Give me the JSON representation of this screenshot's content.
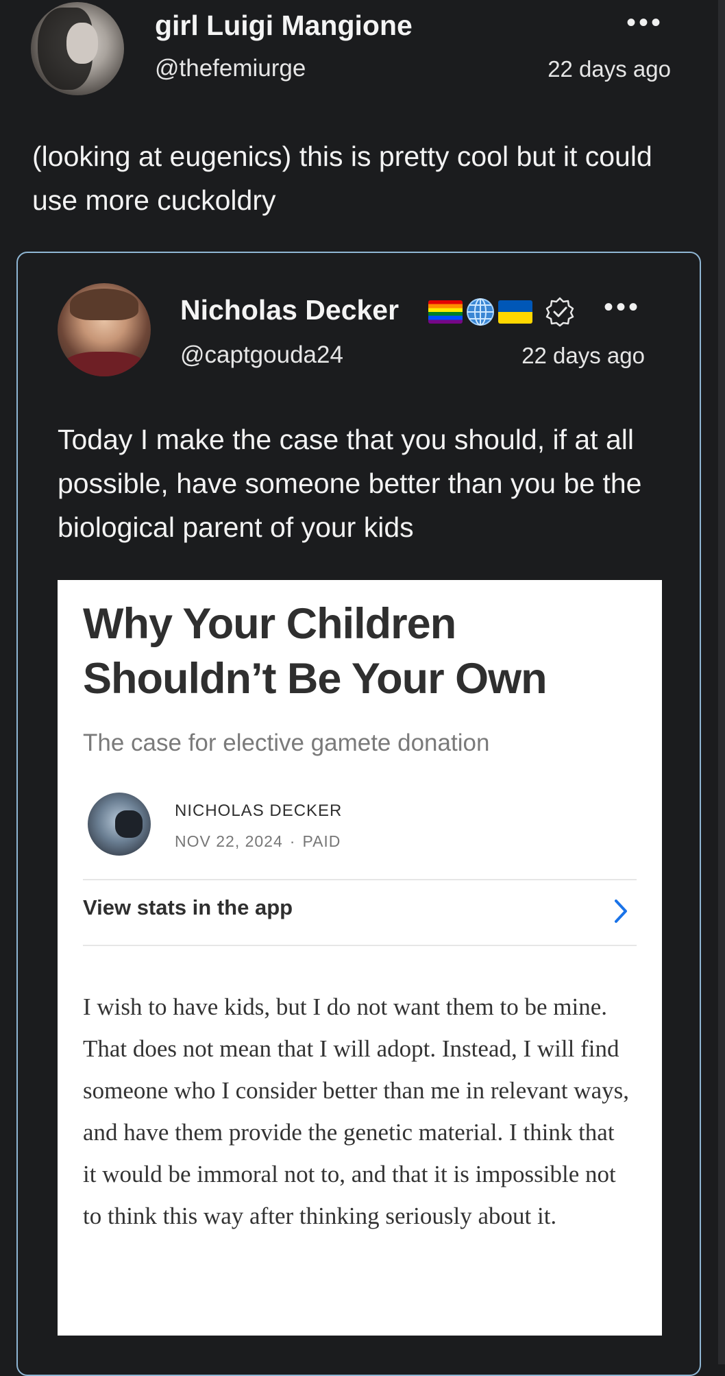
{
  "post": {
    "display_name": "girl Luigi Mangione",
    "handle": "@thefemiurge",
    "timestamp": "22 days ago",
    "more_label": "•••",
    "text": "(looking at eugenics) this is pretty cool but it could use more cuckoldry"
  },
  "quoted_post": {
    "display_name": "Nicholas Decker",
    "badges": [
      "rainbow-flag-icon",
      "globe-icon",
      "ukraine-flag-icon",
      "verified-badge-icon"
    ],
    "handle": "@captgouda24",
    "timestamp": "22 days ago",
    "more_label": "•••",
    "text": "Today I make the case that you should, if at all possible, have someone better than you be the biological parent of your kids"
  },
  "article": {
    "title": "Why Your Children Shouldn’t Be Your Own",
    "subtitle": "The case for elective gamete donation",
    "author": "NICHOLAS DECKER",
    "date": "NOV 22, 2024",
    "dot": "·",
    "access": "PAID",
    "stats_label": "View stats in the app",
    "body": "I wish to have kids, but I do not want them to be mine. That does not mean that I will adopt. Instead, I will find someone who I consider better than me in relevant ways, and have them provide the genetic material. I think that it would be immoral not to, and that it is impossible not to think this way after thinking seriously about it."
  },
  "colors": {
    "background": "#1b1c1e",
    "quote_border": "#8fb6d4",
    "stats_chevron": "#1a73e8"
  }
}
